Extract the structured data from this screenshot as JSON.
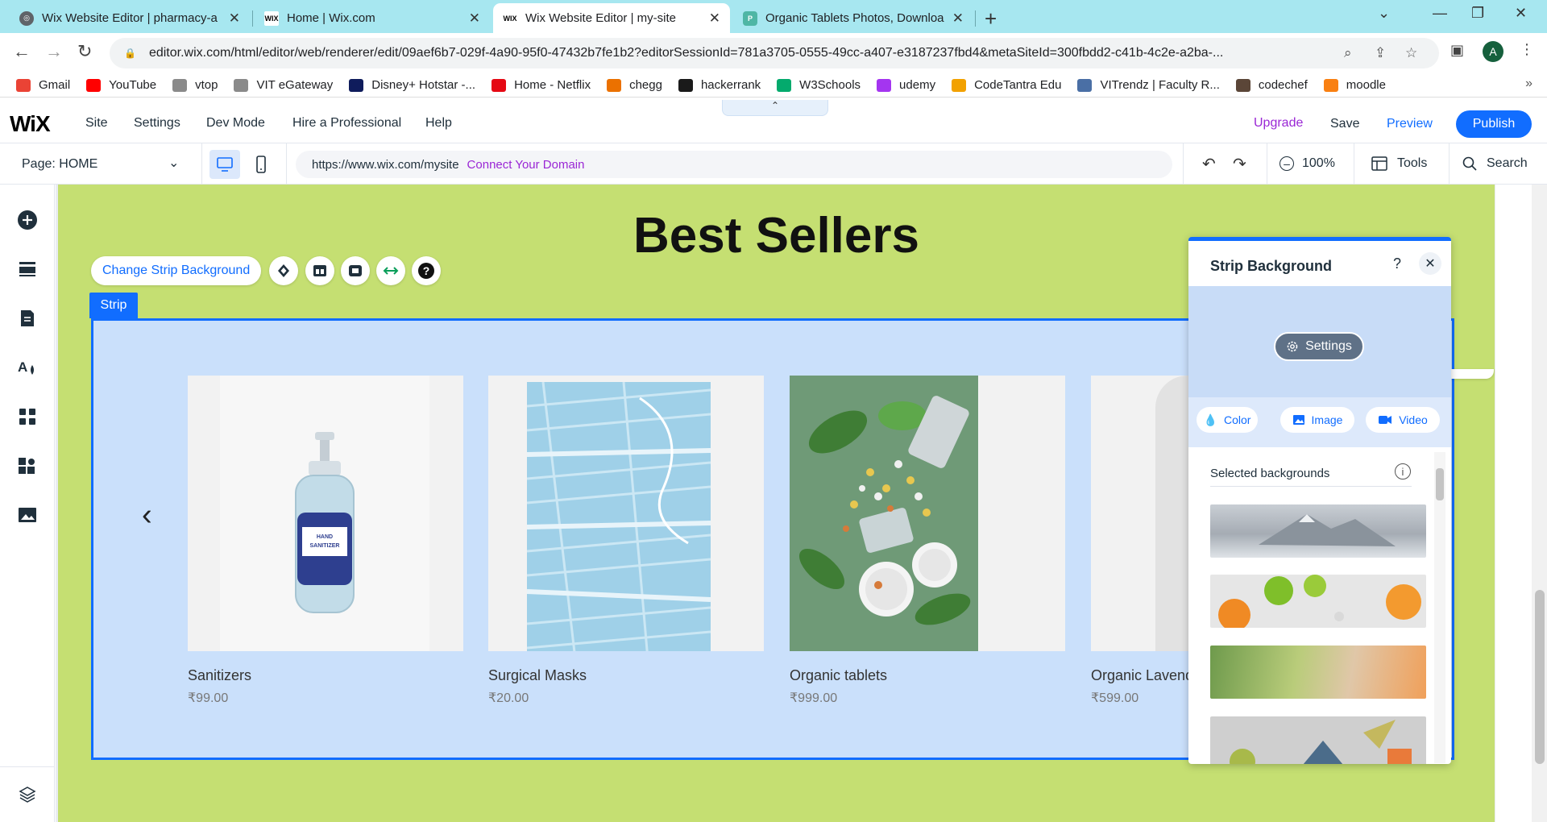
{
  "browser": {
    "tabs": [
      {
        "title": "Wix Website Editor | pharmacy-a",
        "active": false
      },
      {
        "title": "Home | Wix.com",
        "active": false
      },
      {
        "title": "Wix Website Editor | my-site",
        "active": true
      },
      {
        "title": "Organic Tablets Photos, Downloa",
        "active": false
      }
    ],
    "url": "editor.wix.com/html/editor/web/renderer/edit/09aef6b7-029f-4a90-95f0-47432b7fe1b2?editorSessionId=781a3705-0555-49cc-a407-e3187237fbd4&metaSiteId=300fbdd2-c41b-4c2e-a2ba-...",
    "avatar_letter": "A",
    "bookmarks": [
      {
        "label": "Gmail",
        "icon": "gmail-icon",
        "color": "#ea4335"
      },
      {
        "label": "YouTube",
        "icon": "youtube-icon",
        "color": "#ff0000"
      },
      {
        "label": "vtop",
        "icon": "vtop-icon",
        "color": "#8a8a8a"
      },
      {
        "label": "VIT eGateway",
        "icon": "vit-icon",
        "color": "#8a8a8a"
      },
      {
        "label": "Disney+ Hotstar -...",
        "icon": "hotstar-icon",
        "color": "#0f1c5c"
      },
      {
        "label": "Home - Netflix",
        "icon": "netflix-icon",
        "color": "#e50914"
      },
      {
        "label": "chegg",
        "icon": "chegg-icon",
        "color": "#eb7100"
      },
      {
        "label": "hackerrank",
        "icon": "hackerrank-icon",
        "color": "#1a1a1a"
      },
      {
        "label": "W3Schools",
        "icon": "w3schools-icon",
        "color": "#04aa6d"
      },
      {
        "label": "udemy",
        "icon": "udemy-icon",
        "color": "#a435f0"
      },
      {
        "label": "CodeTantra Edu",
        "icon": "codetantra-icon",
        "color": "#f2a100"
      },
      {
        "label": "VITrendz | Faculty R...",
        "icon": "vitrendz-icon",
        "color": "#4a6fa5"
      },
      {
        "label": "codechef",
        "icon": "codechef-icon",
        "color": "#5b4638"
      },
      {
        "label": "moodle",
        "icon": "moodle-icon",
        "color": "#f98012"
      }
    ]
  },
  "wix": {
    "logo": "WiX",
    "menu": [
      "Site",
      "Settings",
      "Dev Mode",
      "Hire a Professional",
      "Help"
    ],
    "upgrade": "Upgrade",
    "save": "Save",
    "preview": "Preview",
    "publish": "Publish",
    "page_selector": "Page: HOME",
    "site_url": "https://www.wix.com/mysite",
    "connect_domain": "Connect Your Domain",
    "zoom": "100%",
    "tools": "Tools",
    "search": "Search"
  },
  "canvas": {
    "heading": "Best Sellers",
    "change_strip_bg": "Change Strip Background",
    "strip_tag": "Strip",
    "products": [
      {
        "name": "Sanitizers",
        "price": "₹99.00"
      },
      {
        "name": "Surgical Masks",
        "price": "₹20.00"
      },
      {
        "name": "Organic tablets",
        "price": "₹999.00"
      },
      {
        "name": "Organic Lavend",
        "price": "₹599.00"
      }
    ]
  },
  "panel": {
    "title": "Strip Background",
    "help": "?",
    "settings": "Settings",
    "tabs": [
      "Color",
      "Image",
      "Video"
    ],
    "selected_label": "Selected backgrounds",
    "accent": "#116dff"
  }
}
